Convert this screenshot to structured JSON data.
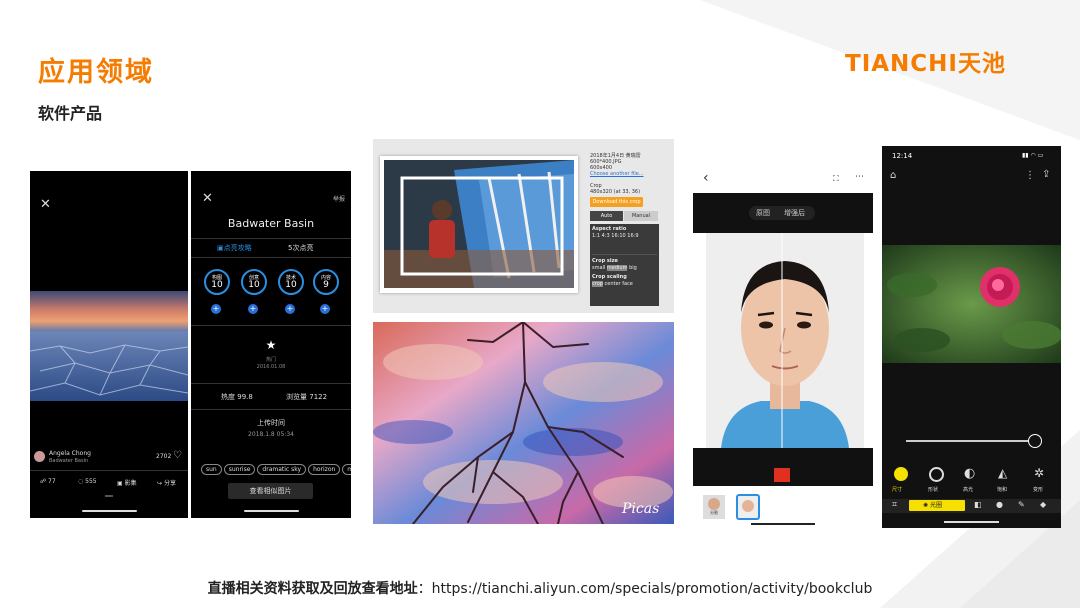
{
  "header": {
    "title": "应用领域",
    "subtitle": "软件产品",
    "logo_latin": "TIANCHI",
    "logo_cn": "天池"
  },
  "footer": {
    "label": "直播相关资料获取及回放查看地址",
    "sep": "：",
    "url": "https://tianchi.aliyun.com/specials/promotion/activity/bookclub"
  },
  "phone1": {
    "user": "Angela Chong",
    "location": "Badwater Basin",
    "likes": "2702",
    "stat_a": "77",
    "stat_b": "555",
    "stat_c": "影集",
    "share": "分享"
  },
  "phone2": {
    "report": "举报",
    "title": "Badwater Basin",
    "tab_a": "点亮攻略",
    "tab_b": "5次点亮",
    "scores": [
      {
        "label": "构图",
        "value": "10"
      },
      {
        "label": "创意",
        "value": "10"
      },
      {
        "label": "技术",
        "value": "10"
      },
      {
        "label": "内容",
        "value": "9"
      }
    ],
    "badge_label": "热门",
    "badge_date": "2016.01.08",
    "heat_label": "热度",
    "heat": "99.8",
    "views_label": "浏览量",
    "views": "7122",
    "upload_label": "上传时间",
    "upload_time": "2018.1.8  05:34",
    "tags": [
      "sun",
      "sunrise",
      "dramatic sky",
      "horizon",
      "moo"
    ],
    "similar_button": "查看相似图片"
  },
  "crop": {
    "file_title": "2018年1月4日 黄瑞雷",
    "file_name": "600*400.JPG",
    "file_size": "600x400",
    "choose": "Choose another file...",
    "crop_label": "Crop",
    "crop_value": "480x320 (at 33, 36)",
    "download": "Download this crop",
    "auto": "Auto",
    "manual": "Manual",
    "aspect_label": "Aspect ratio",
    "ratios": [
      "1:1",
      "4:3",
      "16:10",
      "16:9"
    ],
    "size_label": "Crop size",
    "sizes": [
      "small",
      "medium",
      "big"
    ],
    "scaling_label": "Crop scaling",
    "scalings": [
      "crop",
      "center",
      "face"
    ]
  },
  "painting": {
    "watermark": "Picas"
  },
  "face": {
    "seg_a": "原图",
    "seg_b": "增强后",
    "thumb_label": "分割"
  },
  "phone3": {
    "time": "12:14",
    "tools": [
      "尺寸",
      "形状",
      "高光",
      "饱和",
      "变形"
    ],
    "active_tool": "光圈"
  },
  "colors": {
    "accent": "#f57c00",
    "blue": "#2a8fe0",
    "yellow": "#f5e000"
  }
}
